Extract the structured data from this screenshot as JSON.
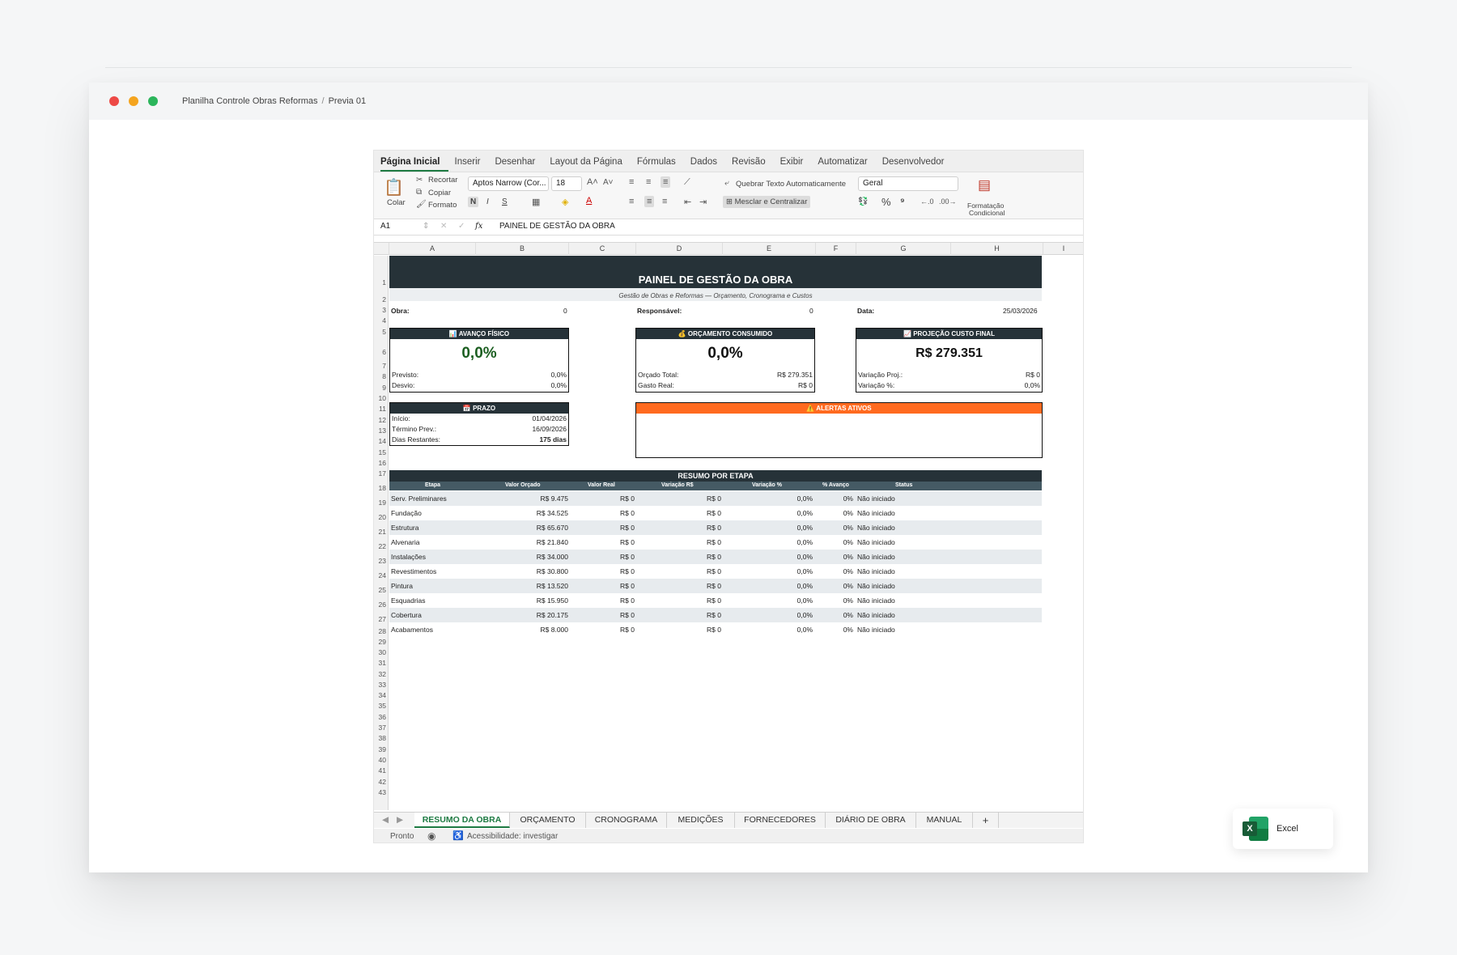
{
  "window": {
    "breadcrumb": [
      "Planilha Controle Obras Reformas",
      "Previa 01"
    ],
    "breadcrumb_sep": "/"
  },
  "ribbon": {
    "tabs": [
      "Página Inicial",
      "Inserir",
      "Desenhar",
      "Layout da Página",
      "Fórmulas",
      "Dados",
      "Revisão",
      "Exibir",
      "Automatizar",
      "Desenvolvedor"
    ],
    "paste": "Colar",
    "cut": "Recortar",
    "copy": "Copiar",
    "format_painter": "Formato",
    "font_name": "Aptos Narrow (Cor...",
    "font_size": "18",
    "bold": "N",
    "italic": "I",
    "underline": "S",
    "wrap_text": "Quebrar Texto Automaticamente",
    "merge_center": "Mesclar e Centralizar",
    "number_format": "Geral",
    "cond_format_1": "Formatação",
    "cond_format_2": "Condicional",
    "percent": "%",
    "comma": "⁹"
  },
  "formula_bar": {
    "name_box": "A1",
    "fx": "fx",
    "content": "PAINEL DE GESTÃO DA OBRA"
  },
  "columns": [
    "A",
    "B",
    "C",
    "D",
    "E",
    "F",
    "G",
    "H",
    "I"
  ],
  "rows": [
    "1",
    "2",
    "3",
    "4",
    "5",
    "6",
    "7",
    "8",
    "9",
    "10",
    "11",
    "12",
    "13",
    "14",
    "15",
    "16",
    "17",
    "18",
    "19",
    "20",
    "21",
    "22",
    "23",
    "24",
    "25",
    "26",
    "27",
    "28",
    "29",
    "30",
    "31",
    "32",
    "33",
    "34",
    "35",
    "36",
    "37",
    "38",
    "39",
    "40",
    "41",
    "42",
    "43"
  ],
  "sheet": {
    "title": "PAINEL DE GESTÃO DA OBRA",
    "subtitle": "Gestão de Obras e Reformas — Orçamento, Cronograma e Custos",
    "obra_label": "Obra:",
    "obra_value": "0",
    "responsavel_label": "Responsável:",
    "responsavel_value": "0",
    "data_label": "Data:",
    "data_value": "25/03/2026",
    "avanco": {
      "header": "📊 AVANÇO FÍSICO",
      "big": "0,0%",
      "previsto_label": "Previsto:",
      "previsto_value": "0,0%",
      "desvio_label": "Desvio:",
      "desvio_value": "0,0%"
    },
    "orcamento": {
      "header": "💰 ORÇAMENTO CONSUMIDO",
      "big": "0,0%",
      "orcado_label": "Orçado Total:",
      "orcado_value": "R$ 279.351",
      "gasto_label": "Gasto Real:",
      "gasto_value": "R$ 0"
    },
    "projecao": {
      "header": "📈 PROJEÇÃO CUSTO FINAL",
      "big": "R$ 279.351",
      "variacao_label": "Variação Proj.:",
      "variacao_value": "R$ 0",
      "variacao_pct_label": "Variação %:",
      "variacao_pct_value": "0,0%"
    },
    "prazo": {
      "header": "📅 PRAZO",
      "inicio_label": "Início:",
      "inicio_value": "01/04/2026",
      "termino_label": "Término Prev.:",
      "termino_value": "16/09/2026",
      "dias_label": "Dias Restantes:",
      "dias_value": "175 dias"
    },
    "alertas": {
      "header": "⚠️ ALERTAS ATIVOS"
    },
    "resumo": {
      "header": "RESUMO POR ETAPA",
      "columns": [
        "Etapa",
        "Valor Orçado",
        "Valor Real",
        "Variação R$",
        "Variação %",
        "% Avanço",
        "Status"
      ],
      "rows": [
        [
          "Serv. Preliminares",
          "R$ 9.475",
          "R$ 0",
          "R$ 0",
          "0,0%",
          "0%",
          "Não iniciado"
        ],
        [
          "Fundação",
          "R$ 34.525",
          "R$ 0",
          "R$ 0",
          "0,0%",
          "0%",
          "Não iniciado"
        ],
        [
          "Estrutura",
          "R$ 65.670",
          "R$ 0",
          "R$ 0",
          "0,0%",
          "0%",
          "Não iniciado"
        ],
        [
          "Alvenaria",
          "R$ 21.840",
          "R$ 0",
          "R$ 0",
          "0,0%",
          "0%",
          "Não iniciado"
        ],
        [
          "Instalações",
          "R$ 34.000",
          "R$ 0",
          "R$ 0",
          "0,0%",
          "0%",
          "Não iniciado"
        ],
        [
          "Revestimentos",
          "R$ 30.800",
          "R$ 0",
          "R$ 0",
          "0,0%",
          "0%",
          "Não iniciado"
        ],
        [
          "Pintura",
          "R$ 13.520",
          "R$ 0",
          "R$ 0",
          "0,0%",
          "0%",
          "Não iniciado"
        ],
        [
          "Esquadrias",
          "R$ 15.950",
          "R$ 0",
          "R$ 0",
          "0,0%",
          "0%",
          "Não iniciado"
        ],
        [
          "Cobertura",
          "R$ 20.175",
          "R$ 0",
          "R$ 0",
          "0,0%",
          "0%",
          "Não iniciado"
        ],
        [
          "Acabamentos",
          "R$ 8.000",
          "R$ 0",
          "R$ 0",
          "0,0%",
          "0%",
          "Não iniciado"
        ]
      ]
    }
  },
  "sheet_tabs": [
    "RESUMO DA OBRA",
    "ORÇAMENTO",
    "CRONOGRAMA",
    "MEDIÇÕES",
    "FORNECEDORES",
    "DIÁRIO DE OBRA",
    "MANUAL"
  ],
  "add_sheet": "+",
  "status": {
    "ready": "Pronto",
    "accessibility": "Acessibilidade: investigar"
  },
  "app_chip": {
    "label": "Excel",
    "logo_letter": "X"
  },
  "colors": {
    "dark_header": "#263238",
    "alert_orange": "#ff6a1f",
    "excel_green": "#1d7a42",
    "avanco_green": "#1b5e20"
  }
}
